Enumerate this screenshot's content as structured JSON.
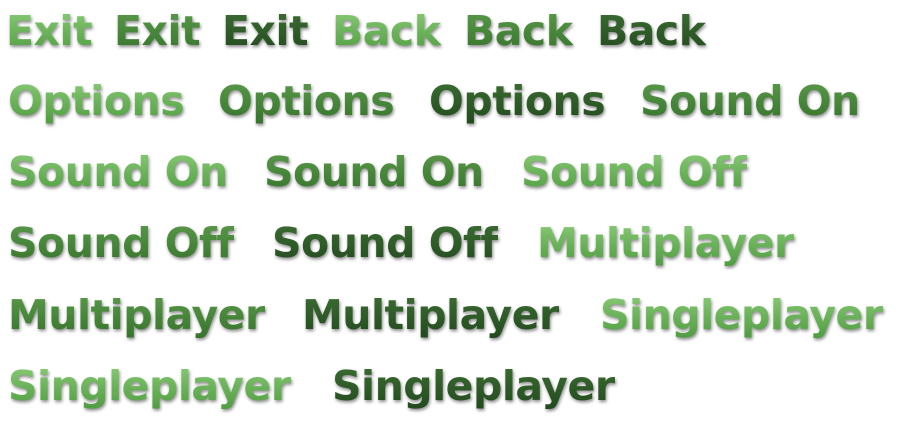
{
  "buttons": {
    "exit_normal": "Exit",
    "exit_hover": "Exit",
    "exit_pressed": "Exit",
    "back_normal": "Back",
    "back_hover": "Back",
    "back_pressed": "Back",
    "options_normal": "Options",
    "options_hover": "Options",
    "options_pressed": "Options",
    "sound_on_normal": "Sound On",
    "sound_on_hover": "Sound On",
    "sound_on_pressed": "Sound On",
    "sound_off_normal": "Sound Off",
    "sound_off_hover": "Sound Off",
    "sound_off_pressed": "Sound Off",
    "multiplayer_normal": "Multiplayer",
    "multiplayer_hover": "Multiplayer",
    "multiplayer_pressed": "Multiplayer",
    "singleplayer_normal": "Singleplayer",
    "singleplayer_hover": "Singleplayer",
    "singleplayer_pressed": "Singleplayer"
  },
  "colors": {
    "normal_top": "#8fcf7d",
    "normal_bottom": "#4e9b40",
    "hover_top": "#5e9a4d",
    "hover_bottom": "#35712b",
    "pressed_top": "#3f6e35",
    "pressed_bottom": "#22481e",
    "background": "#ffffff"
  }
}
